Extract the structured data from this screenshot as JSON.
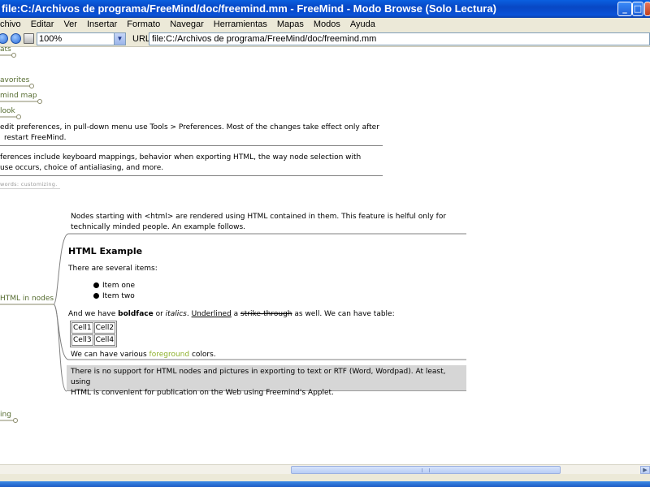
{
  "window": {
    "title": "file:C:/Archivos de programa/FreeMind/doc/freemind.mm - FreeMind - Modo Browse (Solo Lectura)"
  },
  "menu": [
    "chivo",
    "Editar",
    "Ver",
    "Insertar",
    "Formato",
    "Navegar",
    "Herramientas",
    "Mapas",
    "Modos",
    "Ayuda"
  ],
  "toolbar": {
    "zoom_value": "100%",
    "url_label": "URL:",
    "url_value": "file:C:/Archivos de programa/FreeMind/doc/freemind.mm"
  },
  "map": {
    "node_top": "ats",
    "node_favorites": "avorites",
    "node_mindmap": "mind map",
    "node_look": "look",
    "pref_text_1": "edit preferences, in pull-down menu use Tools > Preferences. Most of the changes take effect only after",
    "pref_text_2": "restart FreeMind.",
    "pref2_text_1": "ferences include keyboard mappings, behavior when exporting HTML, the way node selection with",
    "pref2_text_2": "use occurs, choice of antialiasing, and more.",
    "keywords": "words: customizing.",
    "html_intro_1": "Nodes starting with <html> are rendered using HTML contained in them. This feature is helful only for",
    "html_intro_2": "technically minded people. An example follows.",
    "html_example_title": "HTML Example",
    "several_items": "There are several items:",
    "item_one": "Item one",
    "item_two": "Item two",
    "and_we_have": "And we have ",
    "boldface": "boldface",
    "or": " or ",
    "italics": "italics",
    "dot_space": ". ",
    "underlined": "Underlined",
    "a": " a ",
    "strike": "strike-through",
    "as_well": " as well. We can have table:",
    "cells": [
      [
        "Cell1",
        "Cell2"
      ],
      [
        "Cell3",
        "Cell4"
      ]
    ],
    "various_pre": "We can have various ",
    "foreground": "foreground",
    "colors": " colors.",
    "note_1": "There is no support for HTML nodes and pictures in exporting to text or RTF (Word, Wordpad). At least, using",
    "note_2": "HTML is convenient for publication on the Web using Freemind's Applet.",
    "node_html": "HTML in nodes",
    "node_bottom": "ing"
  },
  "colors": {
    "olive_text": "#556b2f",
    "foreground_word": "#8db02a"
  }
}
